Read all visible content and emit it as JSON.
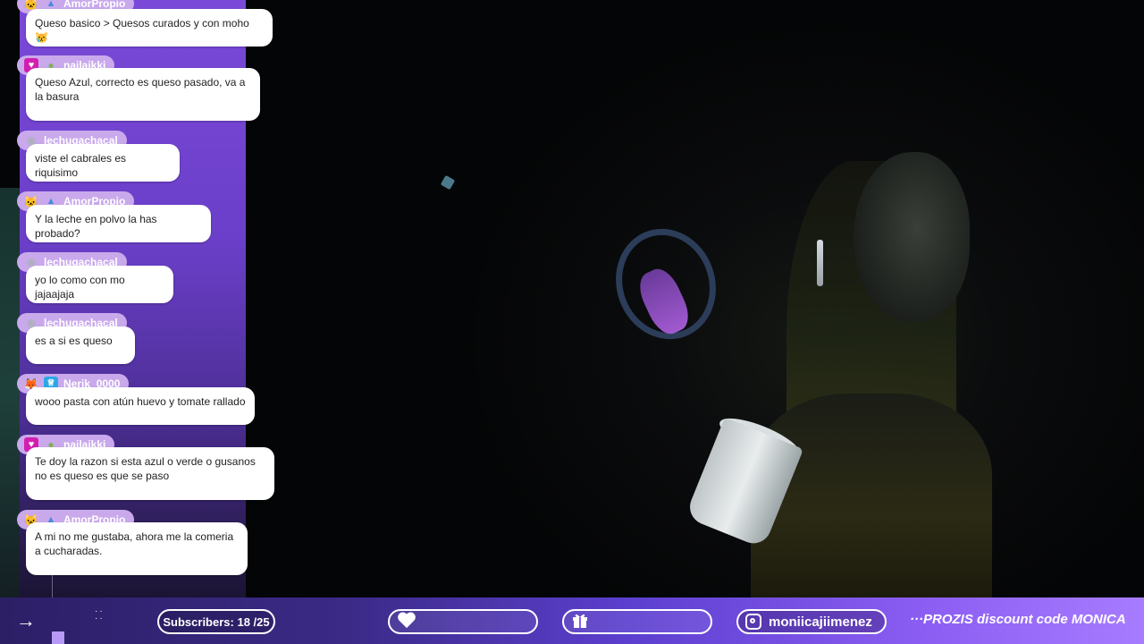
{
  "chat": {
    "messages": [
      {
        "user": "AmorPropio",
        "badges": [
          "cat-badge-icon",
          "mountain-badge-icon"
        ],
        "text": "Queso basico > Quesos curados y con moho 😿"
      },
      {
        "user": "nailaikki",
        "badges": [
          "heart-badge-icon",
          "bear-badge-icon"
        ],
        "text": "Queso Azul, correcto es queso pasado, va a la basura"
      },
      {
        "user": "lechugachacal",
        "badges": [
          "raccoon-badge-icon"
        ],
        "text": "viste el cabrales es riquisimo"
      },
      {
        "user": "AmorPropio",
        "badges": [
          "cat-badge-icon",
          "mountain-badge-icon"
        ],
        "text": "Y la leche en polvo la has probado?"
      },
      {
        "user": "lechugachacal",
        "badges": [
          "raccoon-badge-icon"
        ],
        "text": "yo lo como con mo jajaajaja"
      },
      {
        "user": "lechugachacal",
        "badges": [
          "raccoon-badge-icon"
        ],
        "text": "es a si es queso"
      },
      {
        "user": "Nerik_0000",
        "badges": [
          "fox-badge-icon",
          "crown-badge-icon"
        ],
        "text": "wooo pasta con atún huevo y tomate rallado"
      },
      {
        "user": "nailaikki",
        "badges": [
          "heart-badge-icon",
          "bear-badge-icon"
        ],
        "text": "Te doy la razon si esta azul o verde o gusanos no es queso es que se paso"
      },
      {
        "user": "AmorPropio",
        "badges": [
          "cat-badge-icon",
          "mountain-badge-icon"
        ],
        "text": "A mi no me gustaba, ahora me la comeria a cucharadas."
      }
    ]
  },
  "bottom_bar": {
    "subscribers_label": "Subscribers: 18 /25",
    "subscribers_current": 18,
    "subscribers_goal": 25,
    "instagram_handle": "moniicajiimenez",
    "ticker_text": "···PROZIS discount code MONICA",
    "heart_icon": "heart-icon",
    "gift_icon": "gift-icon",
    "arrow_icon": "arrow-right-icon"
  },
  "colors": {
    "accent_purple": "#7a49d8",
    "user_pill": "#c9a9ec",
    "bar_end": "#a77cff"
  }
}
